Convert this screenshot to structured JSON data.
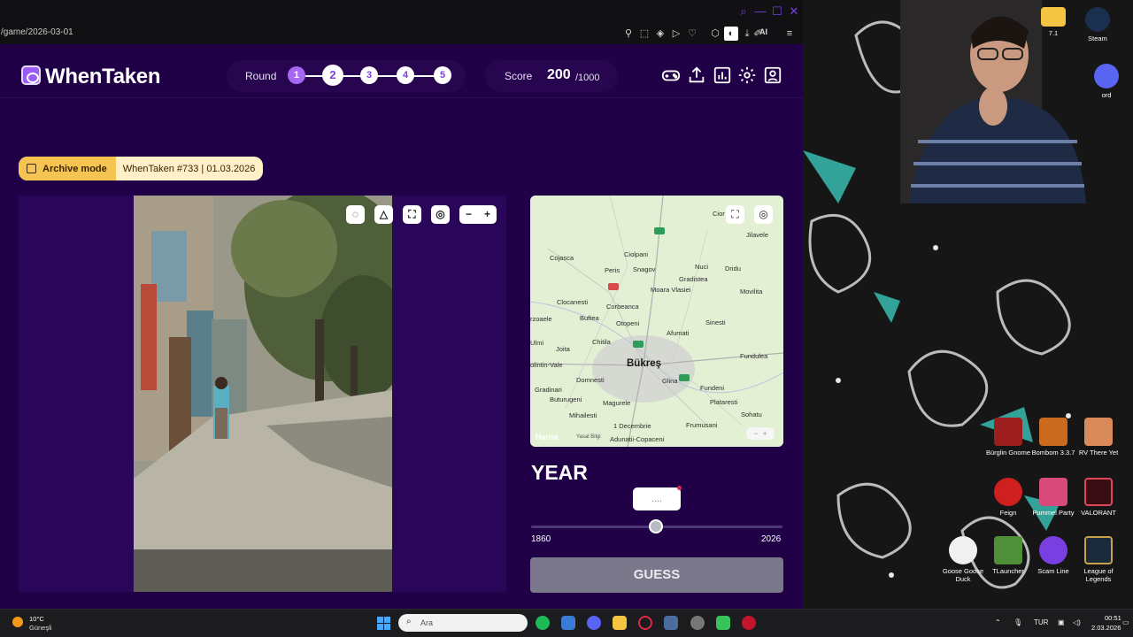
{
  "browser": {
    "url": "/game/2026-03-01",
    "ai_label": "AI"
  },
  "app": {
    "logo": "WhenTaken",
    "round_label": "Round",
    "rounds": [
      "1",
      "2",
      "3",
      "4",
      "5"
    ],
    "score_label": "Score",
    "score_value": "200",
    "score_max": "/1000",
    "archive_mode": "Archive mode",
    "archive_info": "WhenTaken #733 | 01.03.2026"
  },
  "map": {
    "city": "Bükreş",
    "attribution": "Harita",
    "legal": "Yasal Bilgi",
    "labels": [
      "Cojasca",
      "Ciolpani",
      "Peris",
      "Snagov",
      "Nuci",
      "Dridu",
      "Jilavele",
      "Gradistea",
      "Clocanesti",
      "Moara Vlasiei",
      "Movilita",
      "Corbeanca",
      "Buftea",
      "Otopeni",
      "Sinesti",
      "Afumati",
      "Chitila",
      "Joita",
      "Fundulea",
      "Domnesti",
      "Glina",
      "Gradinari",
      "Fundeni",
      "Buturugeni",
      "Magurele",
      "Plataresti",
      "Mihailesti",
      "Sohatu",
      "1 Decembrie",
      "Frumusani",
      "Adunatii-Copaceni",
      "olintin-Vale",
      "rzoaele",
      "Ulmi",
      "Cior"
    ]
  },
  "guess": {
    "title": "YEAR",
    "bubble": "....",
    "min": "1860",
    "max": "2026",
    "button": "GUESS"
  },
  "desktop": {
    "icons": [
      {
        "label": "7.1"
      },
      {
        "label": "Steam"
      },
      {
        "label": "ord"
      },
      {
        "label": "Bürglin Gnome"
      },
      {
        "label": "Bombom 3.3.7"
      },
      {
        "label": "RV There Yet"
      },
      {
        "label": "Feign"
      },
      {
        "label": "Pummel Party"
      },
      {
        "label": "VALORANT"
      },
      {
        "label": "Goose Goose Duck"
      },
      {
        "label": "TLauncher"
      },
      {
        "label": "Scam Line"
      },
      {
        "label": "League of Legends"
      }
    ]
  },
  "taskbar": {
    "temp": "10°C",
    "condition": "Güneşli",
    "search_placeholder": "Ara",
    "lang": "TUR",
    "time": "00:51",
    "date": "2.03.2026"
  }
}
